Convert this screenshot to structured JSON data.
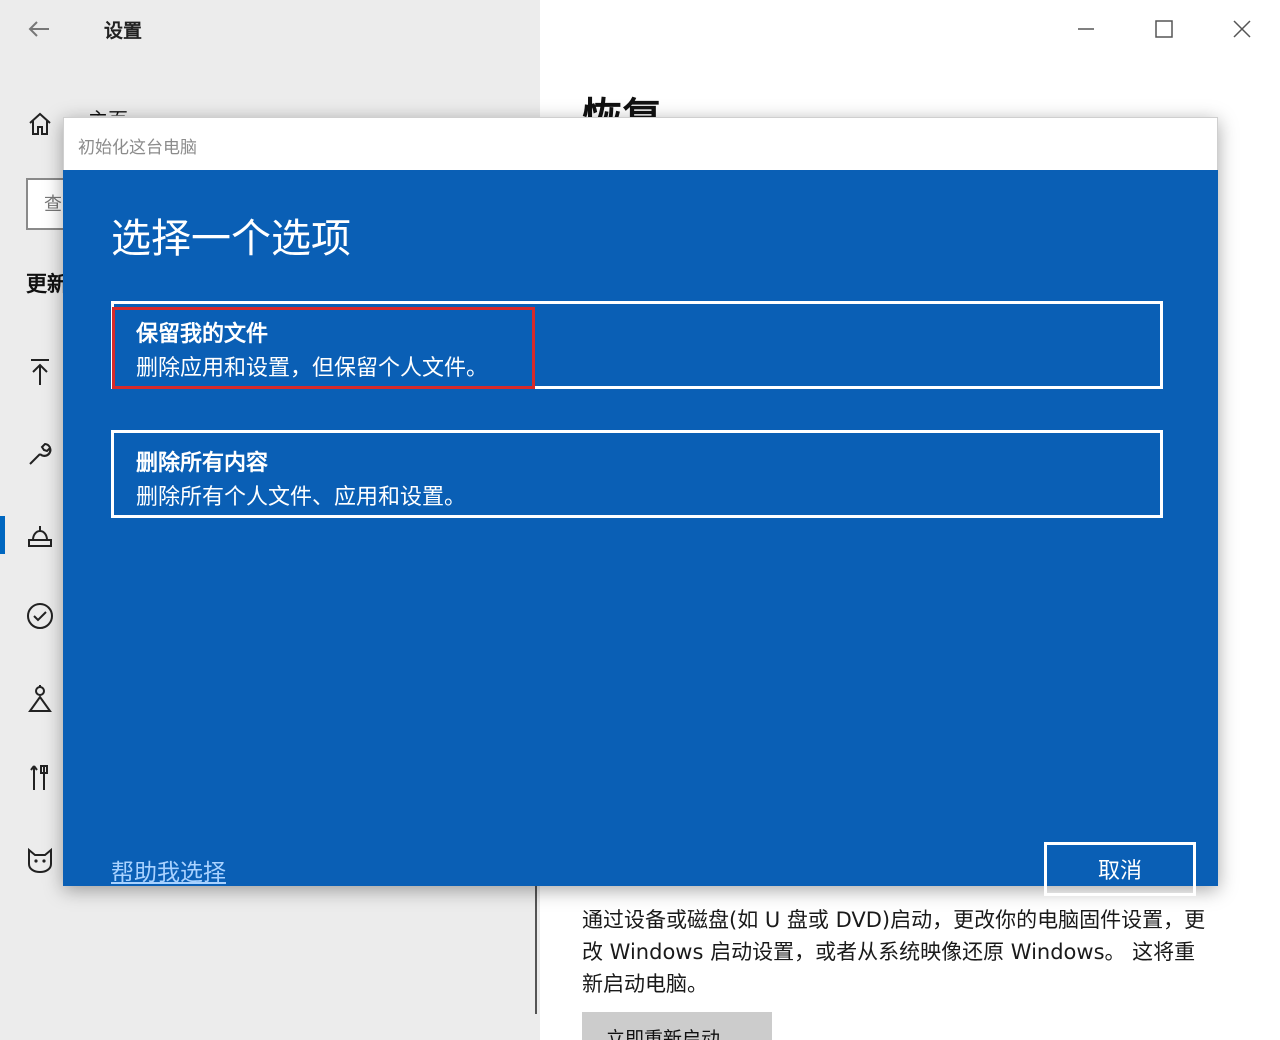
{
  "window": {
    "title": "设置",
    "back_icon": "back-arrow-icon",
    "controls": [
      "minimize-icon",
      "maximize-icon",
      "close-icon"
    ]
  },
  "sidebar": {
    "home_label_fragment": "主页",
    "search_placeholder_fragment": "查",
    "section_fragment": "更新",
    "items": [
      {
        "icon": "upload-arrow-icon"
      },
      {
        "icon": "wrench-icon"
      },
      {
        "icon": "recovery-icon",
        "active": true
      },
      {
        "icon": "checkmark-circle-icon"
      },
      {
        "icon": "person-key-icon"
      },
      {
        "icon": "tools-icon"
      },
      {
        "icon": "cat-face-icon"
      }
    ]
  },
  "main": {
    "heading": "恢复",
    "description": "通过设备或磁盘(如 U 盘或 DVD)启动，更改你的电脑固件设置，更改 Windows 启动设置，或者从系统映像还原 Windows。 这将重新启动电脑。",
    "restart_button": "立即重新启动"
  },
  "dialog": {
    "title": "初始化这台电脑",
    "heading": "选择一个选项",
    "options": [
      {
        "title": "保留我的文件",
        "description": "删除应用和设置，但保留个人文件。",
        "highlighted": true
      },
      {
        "title": "删除所有内容",
        "description": "删除所有个人文件、应用和设置。"
      }
    ],
    "help_link": "帮助我选择",
    "cancel_button": "取消"
  },
  "colors": {
    "dialog_blue": "#0a5fb5",
    "highlight_red": "#d72a2a",
    "accent": "#0067c0"
  }
}
